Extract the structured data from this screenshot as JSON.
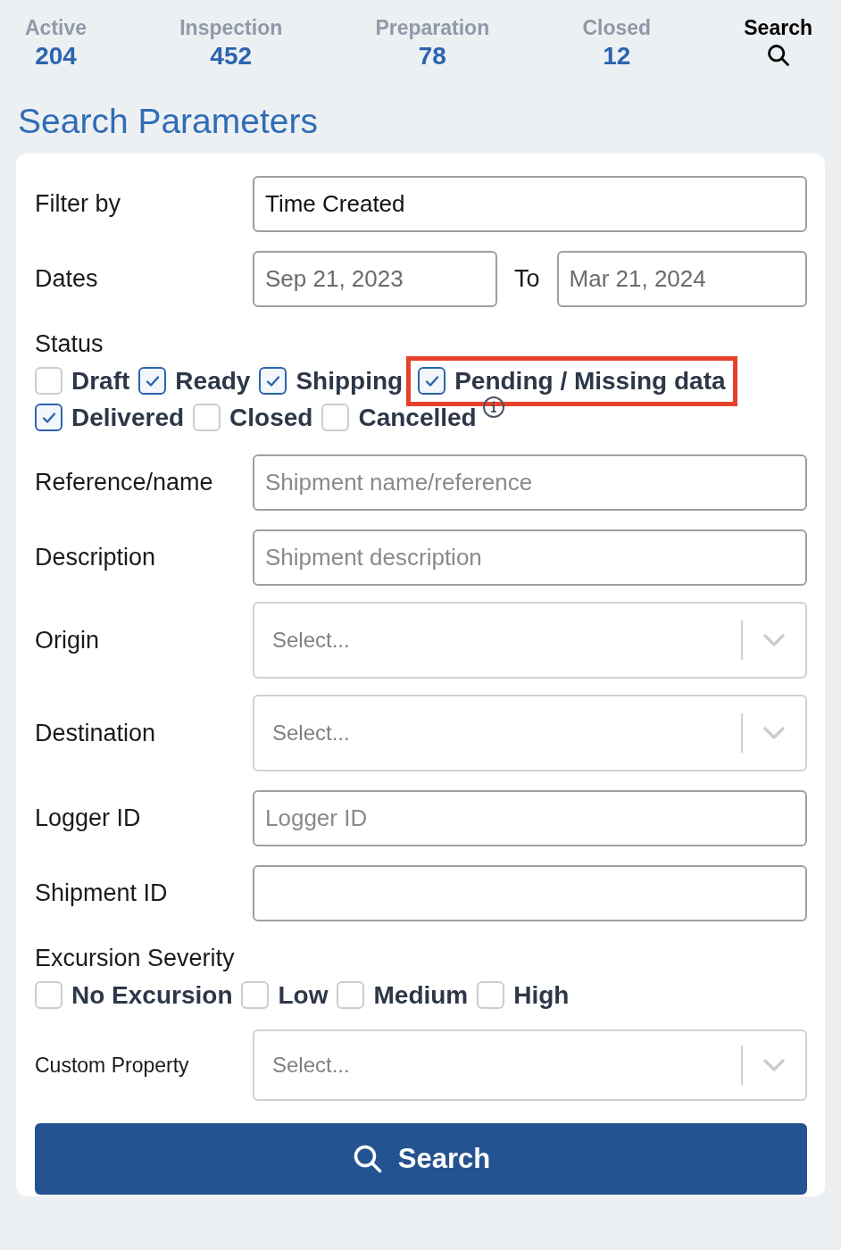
{
  "tabs": [
    {
      "label": "Active",
      "count": "204",
      "selected": false,
      "kind": "count"
    },
    {
      "label": "Inspection",
      "count": "452",
      "selected": false,
      "kind": "count"
    },
    {
      "label": "Preparation",
      "count": "78",
      "selected": false,
      "kind": "count"
    },
    {
      "label": "Closed",
      "count": "12",
      "selected": false,
      "kind": "count"
    },
    {
      "label": "Search",
      "selected": true,
      "kind": "search"
    }
  ],
  "title": "Search Parameters",
  "form": [
    {
      "kind": "input",
      "label": "Filter by",
      "value": "Time Created"
    },
    {
      "kind": "date_range",
      "label": "Dates",
      "from": "Sep 21, 2023",
      "separator": "To",
      "to": "Mar 21, 2024"
    },
    {
      "kind": "checkboxes",
      "label": "Status",
      "options": [
        {
          "label": "Draft",
          "checked": false,
          "highlighted": false
        },
        {
          "label": "Ready",
          "checked": true,
          "highlighted": false
        },
        {
          "label": "Shipping",
          "checked": true,
          "highlighted": false
        },
        {
          "label": "Pending / Missing data",
          "checked": true,
          "highlighted": true
        },
        {
          "label": "Delivered",
          "checked": true,
          "highlighted": false
        },
        {
          "label": "Closed",
          "checked": false,
          "highlighted": false
        },
        {
          "label": "Cancelled",
          "checked": false,
          "highlighted": false,
          "info": true
        }
      ]
    },
    {
      "kind": "input",
      "label": "Reference/name",
      "placeholder": "Shipment name/reference"
    },
    {
      "kind": "input",
      "label": "Description",
      "placeholder": "Shipment description"
    },
    {
      "kind": "select",
      "label": "Origin",
      "placeholder": "Select..."
    },
    {
      "kind": "select",
      "label": "Destination",
      "placeholder": "Select..."
    },
    {
      "kind": "input",
      "label": "Logger ID",
      "placeholder": "Logger ID"
    },
    {
      "kind": "input",
      "label": "Shipment ID"
    },
    {
      "kind": "checkboxes",
      "label": "Excursion Severity",
      "options": [
        {
          "label": "No Excursion",
          "checked": false,
          "highlighted": false
        },
        {
          "label": "Low",
          "checked": false,
          "highlighted": false
        },
        {
          "label": "Medium",
          "checked": false,
          "highlighted": false
        },
        {
          "label": "High",
          "checked": false,
          "highlighted": false
        }
      ]
    },
    {
      "kind": "select",
      "label": "Custom Property",
      "placeholder": "Select...",
      "small_label": true
    }
  ],
  "search_button": "Search"
}
